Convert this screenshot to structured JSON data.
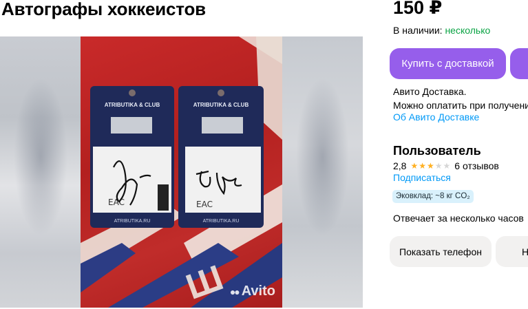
{
  "listing": {
    "title": "Автографы хоккеистов",
    "price": "150 ₽",
    "availability_label": "В наличии:",
    "availability_value": "несколько"
  },
  "actions": {
    "buy_delivery": "Купить с доставкой",
    "show_phone": "Показать телефон",
    "message_partial": "Н"
  },
  "delivery": {
    "line1": "Авито Доставка.",
    "line2": "Можно оплатить при получении",
    "link": "Об Авито Доставке"
  },
  "seller": {
    "name": "Пользователь",
    "rating": "2,8",
    "rating_value": 2.8,
    "stars_filled": 3,
    "stars_total": 5,
    "reviews": "6 отзывов",
    "subscribe": "Подписаться",
    "eco": "Эковклад: ~8 кг CO₂",
    "reply_time": "Отвечает за несколько часов"
  },
  "photo": {
    "tag_brand": "ATRIBUTIKA & CLUB",
    "tag_site": "ATRIBUTIKA.RU",
    "watermark": "Avito"
  },
  "colors": {
    "accent": "#965eeb",
    "link": "#0099f7",
    "in_stock": "#0aa344",
    "star": "#ffb021"
  },
  "icons": {
    "star": "star-icon",
    "eac": "eac-mark-icon",
    "watermark": "avito-logo-icon"
  }
}
